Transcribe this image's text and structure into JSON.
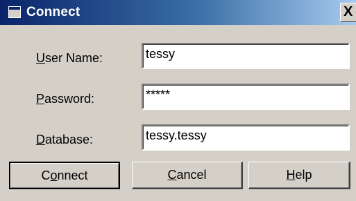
{
  "window": {
    "title": "Connect",
    "close_glyph": "X",
    "title_icon": "window-icon"
  },
  "form": {
    "user_name": {
      "label_mnemonic": "U",
      "label_rest": "ser Name:",
      "value": "tessy"
    },
    "password": {
      "label_mnemonic": "P",
      "label_rest": "assword:",
      "value": "*****"
    },
    "database": {
      "label_mnemonic": "D",
      "label_rest": "atabase:",
      "value": "tessy.tessy"
    }
  },
  "buttons": {
    "connect": {
      "pre": "C",
      "mnemonic": "o",
      "post": "nnect"
    },
    "cancel": {
      "pre": "",
      "mnemonic": "C",
      "post": "ancel"
    },
    "help": {
      "pre": "",
      "mnemonic": "H",
      "post": "elp"
    }
  },
  "colors": {
    "titlebar_start": "#0a246a",
    "titlebar_end": "#a6caf0",
    "dialog_face": "#d4d0c8"
  }
}
